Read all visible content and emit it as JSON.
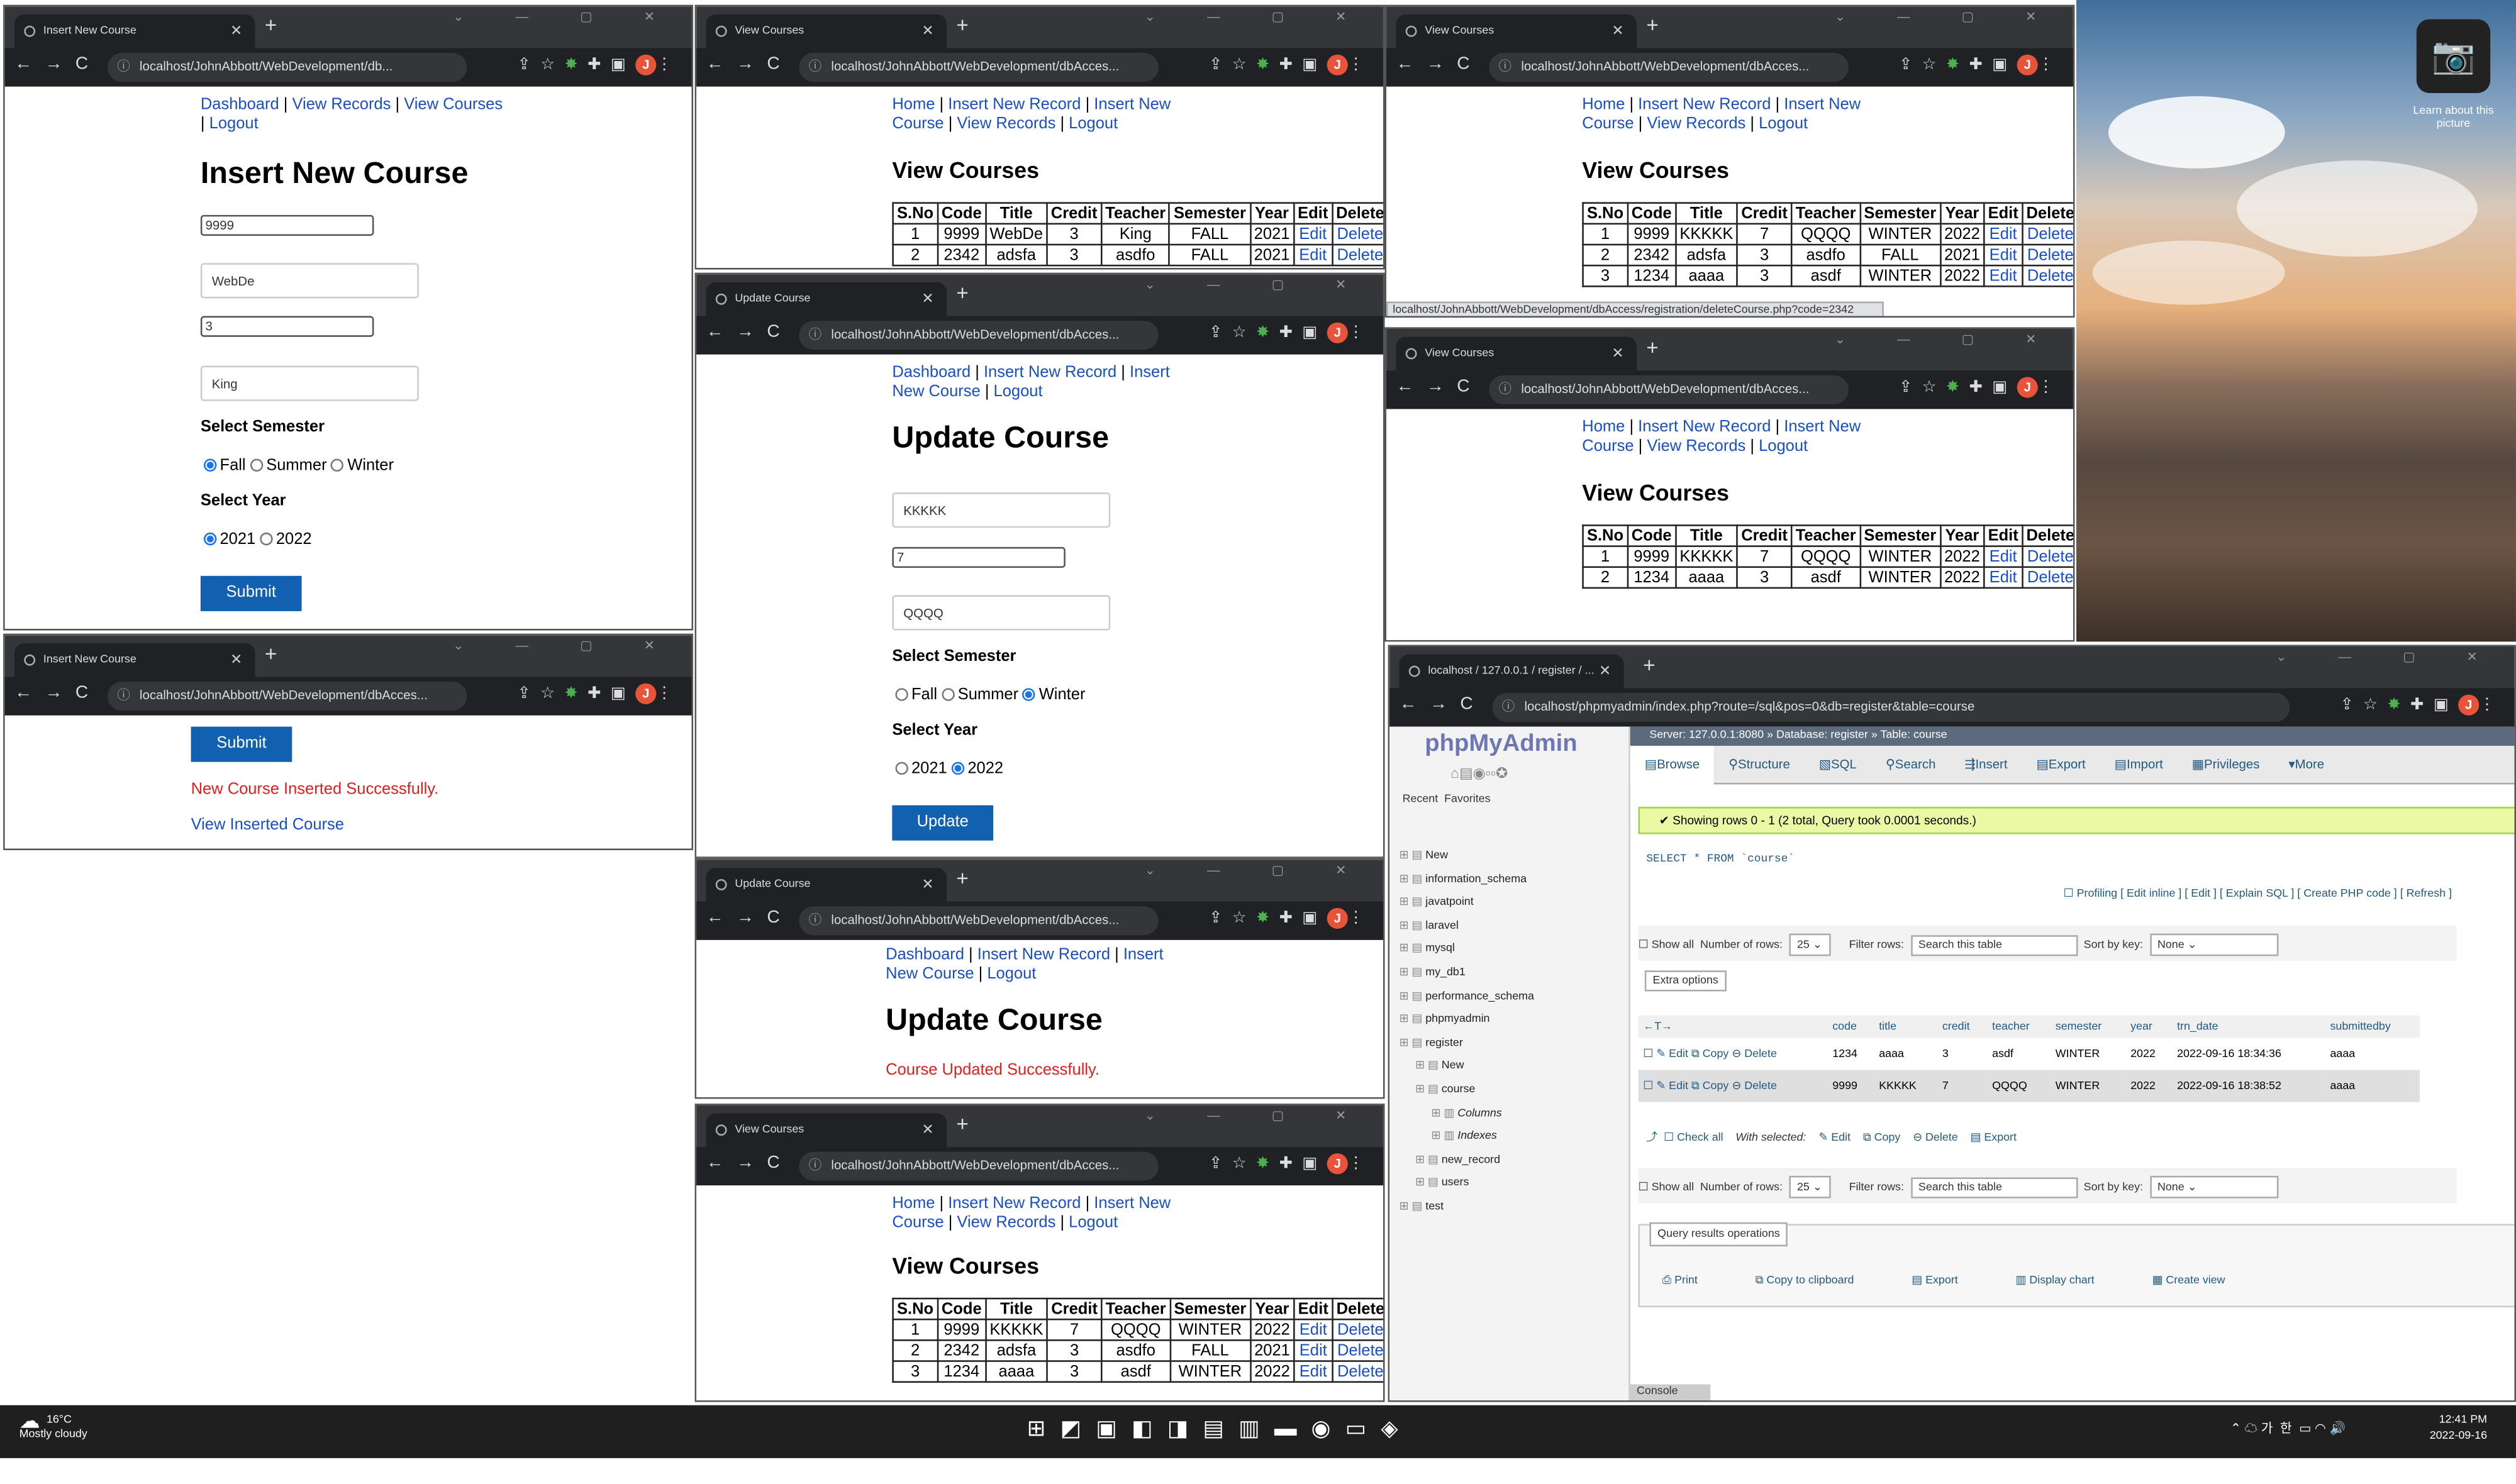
{
  "windows": {
    "w1": {
      "tab": "Insert New Course",
      "url": "localhost/JohnAbbott/WebDevelopment/db...",
      "links": [
        "Dashboard",
        "View Records",
        "View Courses",
        "Logout"
      ],
      "title": "Insert New Course",
      "code": "9999",
      "course_title": "WebDe",
      "credit": "3",
      "teacher": "King",
      "semester_label": "Select Semester",
      "semesters": [
        "Fall",
        "Summer",
        "Winter"
      ],
      "semester_selected": "Fall",
      "year_label": "Select Year",
      "years": [
        "2021",
        "2022"
      ],
      "year_selected": "2021",
      "submit": "Submit"
    },
    "w2": {
      "tab": "View Courses",
      "url": "localhost/JohnAbbott/WebDevelopment/dbAcces...",
      "links": [
        "Home",
        "Insert New Record",
        "Insert New Course",
        "View Records",
        "Logout"
      ],
      "title": "View Courses",
      "headers": [
        "S.No",
        "Code",
        "Title",
        "Credit",
        "Teacher",
        "Semester",
        "Year",
        "Edit",
        "Delete"
      ],
      "rows": [
        [
          "1",
          "9999",
          "WebDe",
          "3",
          "King",
          "FALL",
          "2021",
          "Edit",
          "Delete"
        ],
        [
          "2",
          "2342",
          "adsfa",
          "3",
          "asdfo",
          "FALL",
          "2021",
          "Edit",
          "Delete"
        ]
      ]
    },
    "w3": {
      "tab": "View Courses",
      "url": "localhost/JohnAbbott/WebDevelopment/dbAcces...",
      "links": [
        "Home",
        "Insert New Record",
        "Insert New Course",
        "View Records",
        "Logout"
      ],
      "title": "View Courses",
      "headers": [
        "S.No",
        "Code",
        "Title",
        "Credit",
        "Teacher",
        "Semester",
        "Year",
        "Edit",
        "Delete"
      ],
      "rows": [
        [
          "1",
          "9999",
          "KKKKK",
          "7",
          "QQQQ",
          "WINTER",
          "2022",
          "Edit",
          "Delete"
        ],
        [
          "2",
          "2342",
          "adsfa",
          "3",
          "asdfo",
          "FALL",
          "2021",
          "Edit",
          "Delete"
        ],
        [
          "3",
          "1234",
          "aaaa",
          "3",
          "asdf",
          "WINTER",
          "2022",
          "Edit",
          "Delete"
        ]
      ],
      "status_url": "localhost/JohnAbbott/WebDevelopment/dbAccess/registration/deleteCourse.php?code=2342"
    },
    "w4": {
      "tab": "Insert New Course",
      "url": "localhost/JohnAbbott/WebDevelopment/dbAcces...",
      "submit": "Submit",
      "message": "New Course Inserted Successfully.",
      "link": "View Inserted Course"
    },
    "w5": {
      "tab": "Update Course",
      "url": "localhost/JohnAbbott/WebDevelopment/dbAcces...",
      "links": [
        "Dashboard",
        "Insert New Record",
        "Insert New Course",
        "Logout"
      ],
      "title": "Update Course",
      "course_title": "KKKKK",
      "credit": "7",
      "teacher": "QQQQ",
      "semester_label": "Select Semester",
      "semesters": [
        "Fall",
        "Summer",
        "Winter"
      ],
      "semester_selected": "Winter",
      "year_label": "Select Year",
      "years": [
        "2021",
        "2022"
      ],
      "year_selected": "2022",
      "button": "Update"
    },
    "w6": {
      "tab": "View Courses",
      "url": "localhost/JohnAbbott/WebDevelopment/dbAcces...",
      "links": [
        "Home",
        "Insert New Record",
        "Insert New Course",
        "View Records",
        "Logout"
      ],
      "title": "View Courses",
      "headers": [
        "S.No",
        "Code",
        "Title",
        "Credit",
        "Teacher",
        "Semester",
        "Year",
        "Edit",
        "Delete"
      ],
      "rows": [
        [
          "1",
          "9999",
          "KKKKK",
          "7",
          "QQQQ",
          "WINTER",
          "2022",
          "Edit",
          "Delete"
        ],
        [
          "2",
          "1234",
          "aaaa",
          "3",
          "asdf",
          "WINTER",
          "2022",
          "Edit",
          "Delete"
        ]
      ]
    },
    "w7": {
      "tab": "Update Course",
      "url": "localhost/JohnAbbott/WebDevelopment/dbAcces...",
      "links": [
        "Dashboard",
        "Insert New Record",
        "Insert New Course",
        "Logout"
      ],
      "title": "Update Course",
      "message": "Course Updated Successfully."
    },
    "w8": {
      "tab": "View Courses",
      "url": "localhost/JohnAbbott/WebDevelopment/dbAcces...",
      "links": [
        "Home",
        "Insert New Record",
        "Insert New Course",
        "View Records",
        "Logout"
      ],
      "title": "View Courses",
      "headers": [
        "S.No",
        "Code",
        "Title",
        "Credit",
        "Teacher",
        "Semester",
        "Year",
        "Edit",
        "Delete"
      ],
      "rows": [
        [
          "1",
          "9999",
          "KKKKK",
          "7",
          "QQQQ",
          "WINTER",
          "2022",
          "Edit",
          "Delete"
        ],
        [
          "2",
          "2342",
          "adsfa",
          "3",
          "asdfo",
          "FALL",
          "2021",
          "Edit",
          "Delete"
        ],
        [
          "3",
          "1234",
          "aaaa",
          "3",
          "asdf",
          "WINTER",
          "2022",
          "Edit",
          "Delete"
        ]
      ]
    }
  },
  "pma": {
    "tab": "localhost / 127.0.0.1 / register / ...",
    "url": "localhost/phpmyadmin/index.php?route=/sql&pos=0&db=register&table=course",
    "breadcrumb": "Server: 127.0.0.1:8080 » Database: register » Table: course",
    "tabs": [
      "Browse",
      "Structure",
      "SQL",
      "Search",
      "Insert",
      "Export",
      "Import",
      "Privileges",
      "More"
    ],
    "logo": "phpMyAdmin",
    "recent": "Recent",
    "favorites": "Favorites",
    "tree": [
      "New",
      "information_schema",
      "javatpoint",
      "laravel",
      "mysql",
      "my_db1",
      "performance_schema",
      "phpmyadmin",
      "register",
      "New",
      "course",
      "Columns",
      "Indexes",
      "new_record",
      "users",
      "test"
    ],
    "ok_message": "Showing rows 0 - 1 (2 total, Query took 0.0001 seconds.)",
    "sql": "SELECT * FROM `course`",
    "profiling": "Profiling [ Edit inline ] [ Edit ] [ Explain SQL ] [ Create PHP code ] [ Refresh ]",
    "show_all": "Show all",
    "num_rows_label": "Number of rows:",
    "num_rows": "25",
    "filter_label": "Filter rows:",
    "filter_placeholder": "Search this table",
    "sort_label": "Sort by key:",
    "sort_value": "None",
    "extra": "Extra options",
    "columns": [
      "code",
      "title",
      "credit",
      "teacher",
      "semester",
      "year",
      "trn_date",
      "submittedby"
    ],
    "rows": [
      [
        "1234",
        "aaaa",
        "3",
        "asdf",
        "WINTER",
        "2022",
        "2022-09-16 18:34:36",
        "aaaa"
      ],
      [
        "9999",
        "KKKKK",
        "7",
        "QQQQ",
        "WINTER",
        "2022",
        "2022-09-16 18:38:52",
        "aaaa"
      ]
    ],
    "row_actions": [
      "Edit",
      "Copy",
      "Delete"
    ],
    "check_all": "Check all",
    "with_selected": "With selected:",
    "bulk": [
      "Edit",
      "Copy",
      "Delete",
      "Export"
    ],
    "ops_title": "Query results operations",
    "ops": [
      "Print",
      "Copy to clipboard",
      "Export",
      "Display chart",
      "Create view"
    ],
    "console": "Console"
  },
  "desktop": {
    "camera_label": "Learn about this picture"
  },
  "taskbar": {
    "weather_temp": "16°C",
    "weather_desc": "Mostly cloudy",
    "time": "12:41 PM",
    "date": "2022-09-16",
    "lang": "가",
    "lang2": "한"
  }
}
